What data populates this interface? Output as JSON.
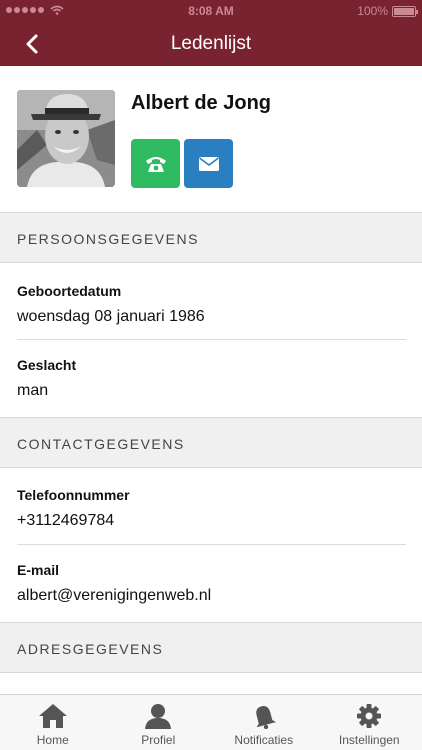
{
  "status_bar": {
    "time": "8:08 AM",
    "battery": "100%",
    "battery_level": 1.0
  },
  "nav": {
    "title": "Ledenlijst",
    "back_icon": "chevron-left-icon"
  },
  "profile": {
    "name": "Albert de Jong",
    "phone_icon": "phone-icon",
    "mail_icon": "envelope-icon"
  },
  "sections": {
    "personal": {
      "title": "PERSOONSGEGEVENS",
      "birthdate_label": "Geboortedatum",
      "birthdate_value": "woensdag 08 januari 1986",
      "gender_label": "Geslacht",
      "gender_value": "man"
    },
    "contact": {
      "title": "CONTACTGEGEVENS",
      "phone_label": "Telefoonnummer",
      "phone_value": "+3112469784",
      "email_label": "E-mail",
      "email_value": "albert@verenigingenweb.nl"
    },
    "address": {
      "title": "ADRESGEGEVENS"
    }
  },
  "tabs": [
    {
      "label": "Home",
      "icon": "home-icon"
    },
    {
      "label": "Profiel",
      "icon": "person-icon"
    },
    {
      "label": "Notificaties",
      "icon": "bell-icon"
    },
    {
      "label": "Instellingen",
      "icon": "gear-icon"
    }
  ],
  "colors": {
    "brand": "#7a2330",
    "phone_button": "#2fbb62",
    "mail_button": "#2a7fc0",
    "section_bg": "#f0f0f0"
  }
}
